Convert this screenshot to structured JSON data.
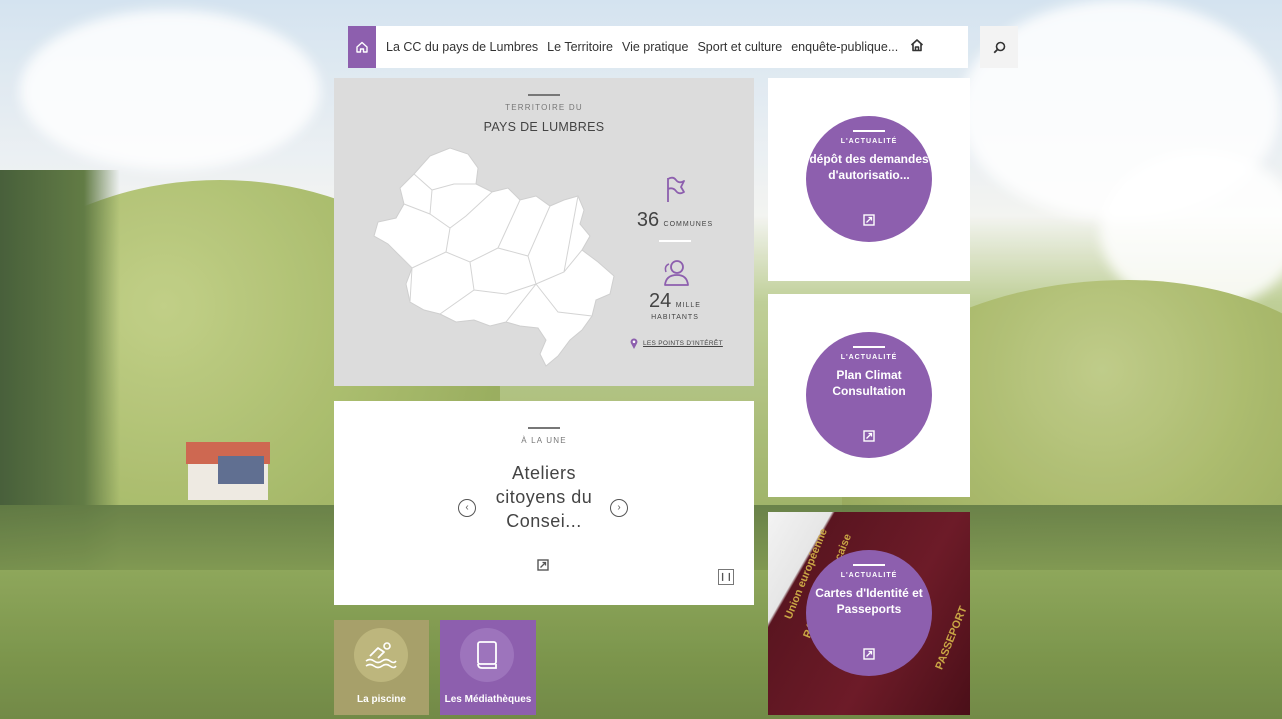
{
  "nav": {
    "items": [
      {
        "label": "La CC du pays de Lumbres"
      },
      {
        "label": "Le Territoire"
      },
      {
        "label": "Vie pratique"
      },
      {
        "label": "Sport et culture"
      },
      {
        "label": "enquête-publique..."
      }
    ]
  },
  "territory": {
    "eyebrow": "TERRITOIRE DU",
    "title": "PAYS DE LUMBRES",
    "communes_value": "36",
    "communes_label": "COMMUNES",
    "habitants_value": "24",
    "habitants_unit": "MILLE",
    "habitants_label": "HABITANTS",
    "poi_link": "LES POINTS D'INTÉRÊT"
  },
  "une": {
    "eyebrow": "À LA UNE",
    "headline": "Ateliers citoyens du Consei..."
  },
  "cards": [
    {
      "eyebrow": "L'ACTUALITÉ",
      "title": "dépôt des demandes d'autorisatio..."
    },
    {
      "eyebrow": "L'ACTUALITÉ",
      "title": "Plan Climat Consultation"
    },
    {
      "eyebrow": "L'ACTUALITÉ",
      "title": "Cartes d'Identité et Passeports"
    }
  ],
  "passport_text": {
    "union": "Union européenne",
    "republique": "République française",
    "passeport": "PASSEPORT"
  },
  "tiles": [
    {
      "label": "La piscine",
      "color": "#a7a06a"
    },
    {
      "label": "Les Médiathèques",
      "color": "#8d5fae"
    }
  ],
  "colors": {
    "accent": "#8d5fae",
    "panel_grey": "#dcdcdc"
  }
}
